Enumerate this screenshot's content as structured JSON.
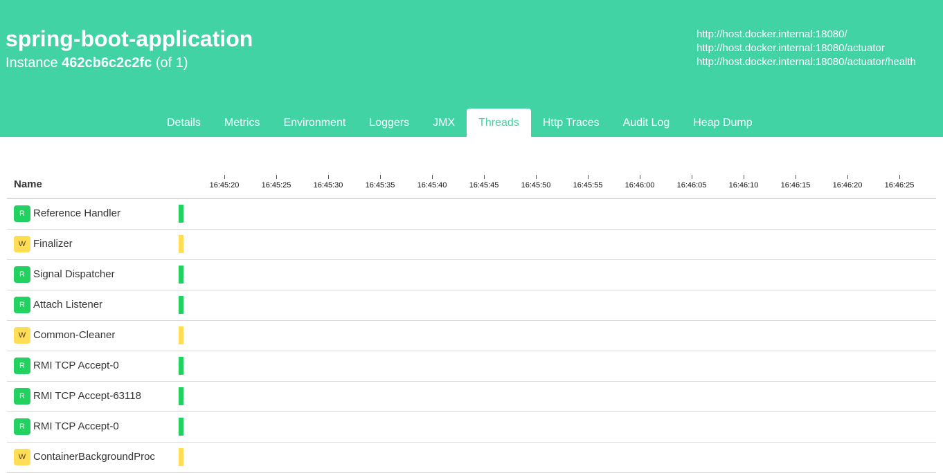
{
  "header": {
    "title": "spring-boot-application",
    "instance_prefix": "Instance",
    "instance_id": "462cb6c2c2fc",
    "instance_suffix": "(of 1)",
    "urls": [
      "http://host.docker.internal:18080/",
      "http://host.docker.internal:18080/actuator",
      "http://host.docker.internal:18080/actuator/health"
    ]
  },
  "tabs": [
    {
      "label": "Details",
      "active": false
    },
    {
      "label": "Metrics",
      "active": false
    },
    {
      "label": "Environment",
      "active": false
    },
    {
      "label": "Loggers",
      "active": false
    },
    {
      "label": "JMX",
      "active": false
    },
    {
      "label": "Threads",
      "active": true
    },
    {
      "label": "Http Traces",
      "active": false
    },
    {
      "label": "Audit Log",
      "active": false
    },
    {
      "label": "Heap Dump",
      "active": false
    }
  ],
  "table": {
    "name_header": "Name",
    "timeline_ticks": [
      "16:45:20",
      "16:45:25",
      "16:45:30",
      "16:45:35",
      "16:45:40",
      "16:45:45",
      "16:45:50",
      "16:45:55",
      "16:46:00",
      "16:46:05",
      "16:46:10",
      "16:46:15",
      "16:46:20",
      "16:46:25"
    ],
    "threads": [
      {
        "state": "R",
        "name": "Reference Handler"
      },
      {
        "state": "W",
        "name": "Finalizer"
      },
      {
        "state": "R",
        "name": "Signal Dispatcher"
      },
      {
        "state": "R",
        "name": "Attach Listener"
      },
      {
        "state": "W",
        "name": "Common-Cleaner"
      },
      {
        "state": "R",
        "name": "RMI TCP Accept-0"
      },
      {
        "state": "R",
        "name": "RMI TCP Accept-63118"
      },
      {
        "state": "R",
        "name": "RMI TCP Accept-0"
      },
      {
        "state": "W",
        "name": "ContainerBackgroundProc"
      }
    ]
  },
  "colors": {
    "brand": "#42d3a5",
    "runnable": "#23d160",
    "waiting": "#ffdd57"
  }
}
